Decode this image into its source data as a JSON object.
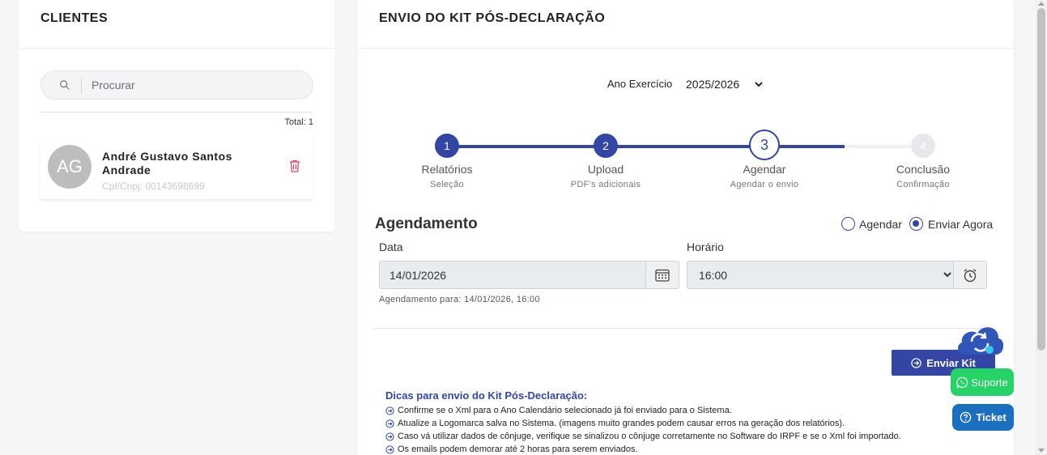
{
  "clients": {
    "title": "CLIENTES",
    "search_placeholder": "Procurar",
    "total": "Total: 1",
    "items": [
      {
        "initials": "AG",
        "name": "André Gustavo Santos Andrade",
        "doc": "Cpf/Cnpj: 00143698699"
      }
    ]
  },
  "main": {
    "title": "ENVIO DO KIT PÓS-DECLARAÇÃO",
    "year_label": "Ano Exercício",
    "year_value": "2025/2026",
    "steps": [
      {
        "number": "1",
        "label": "Relatórios",
        "sub": "Seleção",
        "state": "done"
      },
      {
        "number": "2",
        "label": "Upload",
        "sub": "PDF's adicionais",
        "state": "done"
      },
      {
        "number": "3",
        "label": "Agendar",
        "sub": "Agendar o envio",
        "state": "current"
      },
      {
        "number": "4",
        "label": "Conclusão",
        "sub": "Confirmação",
        "state": "todo"
      }
    ],
    "section_title": "Agendamento",
    "radio_schedule": "Agendar",
    "radio_now": "Enviar Agora",
    "selected_radio": "Enviar Agora",
    "date_label": "Data",
    "date_value": "14/01/2026",
    "time_label": "Horário",
    "time_value": "16:00",
    "schedule_text": "Agendamento para: 14/01/2026, 16:00",
    "send_button": "Enviar Kit",
    "tips_title": "Dicas para envio do Kit Pós-Declaração:",
    "tips": [
      "Confirme se o Xml para o Ano Calendário selecionado já foi enviado para o Sistema.",
      "Atualize a Logomarca salva no Sistema. (imagens muito grandes podem causar erros na geração dos relatórios).",
      "Caso vá utilizar dados de cônjuge, verifique se sinalizou o cônjuge corretamente no Software do IRPF e se o Xml foi importado.",
      "Os emails podem demorar até 2 horas para serem enviados."
    ]
  },
  "widgets": {
    "suporte": "Suporte",
    "ticket": "Ticket"
  },
  "colors": {
    "primary": "#3346a6",
    "whatsapp": "#25d366",
    "ticket": "#1b6fc1",
    "danger": "#e0465a"
  }
}
